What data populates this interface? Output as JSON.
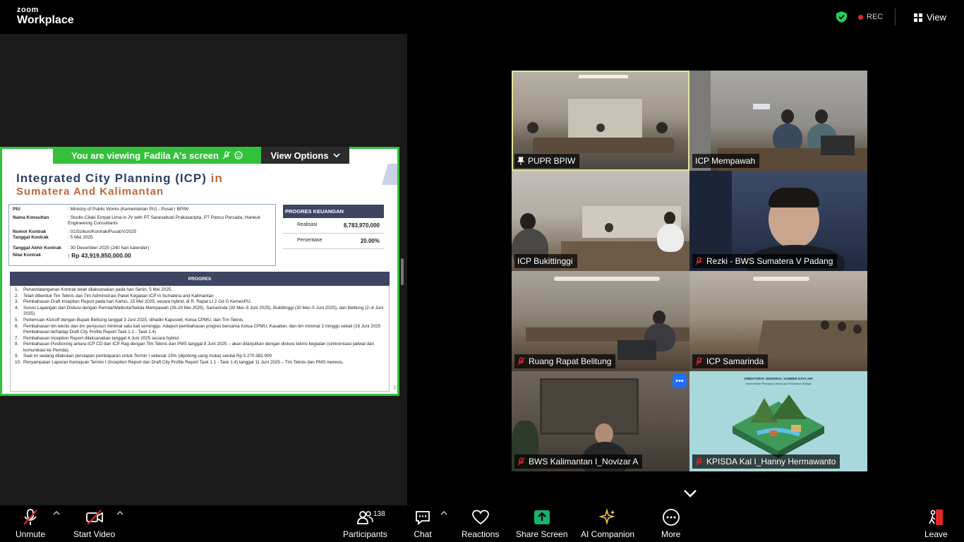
{
  "app": {
    "logo_line1": "zoom",
    "logo_line2": "Workplace"
  },
  "topbar": {
    "rec_label": "REC",
    "view_label": "View"
  },
  "share": {
    "viewing_prefix": "You are viewing",
    "presenter": "Fadila A's screen",
    "view_options": "View Options"
  },
  "slide": {
    "title_line1": "Integrated City Planning (ICP)",
    "title_in": "in",
    "title_line2": "Sumatera And Kalimantan",
    "info": [
      {
        "k": "PIU",
        "v": ": Ministry of Public Works (Kementerian PU) - Pusat I BPIW"
      },
      {
        "k": "Nama Konsultan",
        "v": ": Studio Cilaki Empat Lima in JV with PT Saranabudi Prakasaripta, PT Pancu Persada, Hankuk Engineering Consultants"
      },
      {
        "k": "Nomor Kontrak",
        "v": ": 01/Szikon/Kontrak/Pusat/V/2025"
      },
      {
        "k": "Tanggal Kontrak",
        "v": ": 5 Mei 2025"
      },
      {
        "k": "Tanggal Akhir Kontrak",
        "v": ": 30 Desember 2025 (240 hari kalender)"
      },
      {
        "k": "Nilai Kontrak",
        "v": ": Rp 43,919,850,000.00"
      }
    ],
    "finance": {
      "header": "PROGRES KEUANGAN",
      "realisasi_label": "Realisasi",
      "realisasi_value": "8,783,970,000",
      "persentase_label": "Persentase",
      "persentase_value": "20.00%"
    },
    "progres_header": "PROGRES",
    "progres": [
      "Penandatanganan Kontrak telah dilaksanakan pada hari Senin, 5 Mei 2025.",
      "Telah dibentuk Tim Teknis dan Tim Administrasi Paket Kegiatan ICP in Sumatera and Kalimantan",
      "Pembahasan Draft Inception Report pada hari Kamis, 15 Mei 2025, secara hybrid, di R. Rapat Lt 2 Gd G KemenPU.",
      "Survei Lapangan dan Diskusi dengan Pemda/Walikota/Sekda Mempawah (26-29 Mei 2025), Samarinda (30 Mei–5 Juni 2025), Bukittinggi (30 Mei–5 Juni 2025), dan Belitung (2–4 Juni 2025).",
      "Pertemuan Kickoff dengan Bupati Belitung tanggal 3 Juni 2025, dihadiri Kapuswil, Ketua CPMU, dan Tim Teknis.",
      "Pembahasan tim teknis dan tim penyusun minimal satu kali seminggu. Adapun pembahasan progres bersama Ketua CPMU, Kasatker, dan tim minimal 2 minggu sekali (16 Juni 2025 Pembahasan terhadap Draft City Profile Report Task 1.1 - Task 1.4)",
      "Pembahasan Inception Report dilaksanakan tanggal 4 Juni 2025 secara hybrid.",
      "Pembahasan Positioning antara ICP CD dan ICP Rag dengan Tim Teknis dan PMS tanggal 9 Juni 2025 – akan dilanjutkan dengan diskusi teknis kegiatan (sinkronisasi jadwal dan komunikasi ke Pemda).",
      "Saat ini sedang dilakukan persiapan pembayaran untuk Termin I sebesar 15% (dipotong uang muka) senilai Rp 5.270.382.000",
      "Penyampaian Laporan Kemajuan Termin I (Inception Report dan Draft City Profile Report Task 1.1 - Task 1.4) tanggal 11 Juni 2025 – Tim Teknis dan PMS mereviu."
    ],
    "page_number": "2"
  },
  "tiles": [
    {
      "name": "PUPR BPIW",
      "muted": false,
      "pinned": true
    },
    {
      "name": "ICP Mempawah",
      "muted": false,
      "pinned": false
    },
    {
      "name": "ICP Bukittinggi",
      "muted": false,
      "pinned": false
    },
    {
      "name": "Rezki - BWS Sumatera V Padang",
      "muted": true,
      "pinned": false
    },
    {
      "name": "Ruang Rapat Belitung",
      "muted": true,
      "pinned": false
    },
    {
      "name": "ICP Samarinda",
      "muted": true,
      "pinned": false
    },
    {
      "name": "BWS Kalimantan I_Novizar A",
      "muted": true,
      "pinned": false
    },
    {
      "name": "KPISDA Kal I_Hanny Hermawanto",
      "muted": true,
      "pinned": false
    }
  ],
  "tile8_banner": "DIREKTORAT JENDERAL SUMBER DAYA AIR",
  "tile8_sub": "Kementerian Pekerjaan Umum dan Perumahan Rakyat",
  "toolbar": {
    "unmute": "Unmute",
    "start_video": "Start Video",
    "participants": "Participants",
    "participants_count": "138",
    "chat": "Chat",
    "reactions": "Reactions",
    "share_screen": "Share Screen",
    "ai_companion": "AI Companion",
    "more": "More",
    "leave": "Leave"
  },
  "colors": {
    "share_green": "#33c13b",
    "share_screen_green": "#17b26a",
    "rec_red": "#e02828",
    "active_speaker": "#e5e59a",
    "mute_red": "#e02828"
  }
}
